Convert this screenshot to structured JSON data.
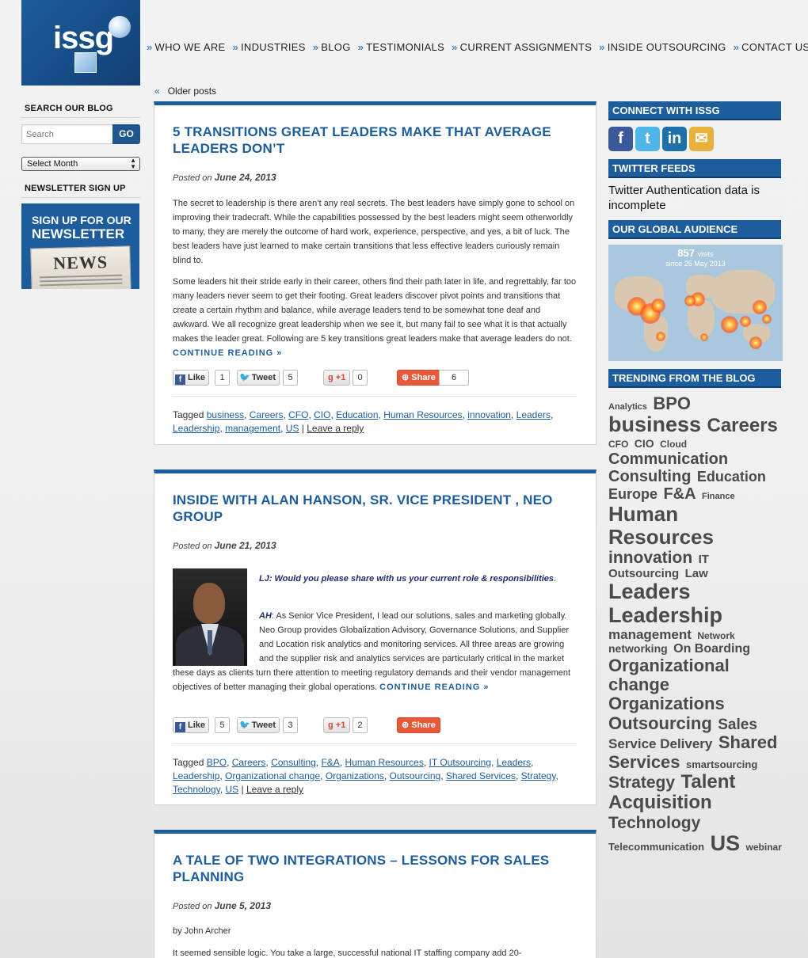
{
  "logo": {
    "text": "issg"
  },
  "nav": [
    "WHO WE ARE",
    "INDUSTRIES",
    "BLOG",
    "TESTIMONIALS",
    "CURRENT ASSIGNMENTS",
    "INSIDE OUTSOURCING",
    "CONTACT US"
  ],
  "nav_separator": "»",
  "older": {
    "arrow": "«",
    "label": "Older posts"
  },
  "left_sidebar": {
    "search_heading": "SEARCH OUR BLOG",
    "search_placeholder": "Search",
    "go_label": "GO",
    "month_select": "Select Month",
    "newsletter_heading": "NEWSLETTER SIGN UP",
    "newsletter_line1": "SIGN UP FOR OUR",
    "newsletter_line2": "NEWSLETTER",
    "newspaper_title": "NEWS"
  },
  "posts": [
    {
      "title": "5 TRANSITIONS GREAT LEADERS MAKE THAT AVERAGE LEADERS DON’T",
      "posted_on": "Posted on",
      "date": "June 24, 2013",
      "paragraphs": [
        "The secret to leadership is there aren’t any real secrets. The best leaders have simply gone to school on improving their tradecraft. While the capabilities possessed by the best leaders might seem otherworldly to many, they are merely the outcome of hard work, experience, perspective, and yes, a bit of luck. The best leaders have just learned to make certain transitions that less effective leaders curiously remain blind to.",
        "Some leaders hit their stride early in their career, others find their path later in life, and regrettably, far too many leaders never seem to get their footing. Great leaders discover pivot points and transitions that create a certain rhythm and balance, while average leaders tend to be somewhat tone deaf and awkward. We all recognize great leadership when we see it, but many fail to see what it is that actually makes the leader great. Following are 5 key transitions great leaders make that average leaders do not."
      ],
      "continue": "CONTINUE READING »",
      "share": {
        "like": "Like",
        "like_count": "1",
        "tweet": "Tweet",
        "tweet_count": "5",
        "gplus": "+1",
        "gplus_count": "0",
        "share": "Share",
        "share_count": "6"
      },
      "tagged": "Tagged",
      "tags": [
        "business",
        "Careers",
        "CFO",
        "CIO",
        "Education",
        "Human Resources",
        "innovation",
        "Leaders",
        "Leadership",
        "management",
        "US"
      ],
      "reply": "Leave a reply"
    },
    {
      "title": "INSIDE WITH ALAN HANSON, SR. VICE PRESIDENT , NEO GROUP",
      "posted_on": "Posted on",
      "date": "June 21, 2013",
      "question": "LJ: Would you please share with us your current role & responsibilities",
      "answer_label": "AH",
      "answer": ":  As Senior Vice President, I lead our solutions, sales and marketing globally. Neo Group provides Globalization Advisory, Governance Solutions, and Supplier and Location risk analytics and monitoring services.  All three areas are growing and the supplier risk and analytics services are particularly critical in the market these days as clients turn there attention to meeting regulatory demands and their vendor management objectives of better managing their global operations.",
      "continue": "CONTINUE READING »",
      "share": {
        "like": "Like",
        "like_count": "5",
        "tweet": "Tweet",
        "tweet_count": "3",
        "gplus": "+1",
        "gplus_count": "2",
        "share": "Share"
      },
      "tagged": "Tagged",
      "tags": [
        "BPO",
        "Careers",
        "Consulting",
        "F&A",
        "Human Resources",
        "IT Outsourcing",
        "Leaders",
        "Leadership",
        "Organizational change",
        "Organizations",
        "Outsourcing",
        "Shared Services",
        "Strategy",
        "Technology",
        "US"
      ],
      "reply": "Leave a reply"
    },
    {
      "title": "A TALE OF TWO INTEGRATIONS – LESSONS FOR SALES PLANNING",
      "posted_on": "Posted on",
      "date": "June 5, 2013",
      "byline": "by John Archer",
      "para": "It seemed sensible logic.  You take a large, successful national IT staffing company add 20-"
    }
  ],
  "right_sidebar": {
    "connect_heading": "CONNECT WITH ISSG",
    "social": [
      {
        "icon": "facebook-icon",
        "glyph": "f",
        "color": "#3b5998"
      },
      {
        "icon": "twitter-icon",
        "glyph": "t",
        "color": "#4fb7e8"
      },
      {
        "icon": "linkedin-icon",
        "glyph": "in",
        "color": "#1f70a8"
      },
      {
        "icon": "email-icon",
        "glyph": "✉",
        "color": "#e8b23a"
      }
    ],
    "twitter_heading": "TWITTER FEEDS",
    "twitter_msg": "Twitter Authentication data is incomplete",
    "audience_heading": "OUR GLOBAL AUDIENCE",
    "visits": "857",
    "visits_unit": "visits",
    "since": "since 25 May 2013",
    "trending_heading": "TRENDING FROM THE BLOG",
    "cloud": [
      {
        "t": "Analytics",
        "s": 11
      },
      {
        "t": "BPO",
        "s": 22
      },
      {
        "t": "business",
        "s": 27
      },
      {
        "t": "Careers",
        "s": 24
      },
      {
        "t": "CFO",
        "s": 12
      },
      {
        "t": "CIO",
        "s": 14
      },
      {
        "t": "Cloud",
        "s": 12
      },
      {
        "t": "Communication",
        "s": 20
      },
      {
        "t": "Consulting",
        "s": 20
      },
      {
        "t": "Education",
        "s": 18
      },
      {
        "t": "Europe",
        "s": 18
      },
      {
        "t": "F&A",
        "s": 20
      },
      {
        "t": "Finance",
        "s": 11
      },
      {
        "t": "Human Resources",
        "s": 26
      },
      {
        "t": "innovation",
        "s": 21
      },
      {
        "t": "IT Outsourcing",
        "s": 15
      },
      {
        "t": "Law",
        "s": 15
      },
      {
        "t": "Leaders",
        "s": 27
      },
      {
        "t": "Leadership",
        "s": 27
      },
      {
        "t": "management",
        "s": 17
      },
      {
        "t": "Network",
        "s": 12
      },
      {
        "t": "networking",
        "s": 14
      },
      {
        "t": "On Boarding",
        "s": 16
      },
      {
        "t": "Organizational change",
        "s": 22
      },
      {
        "t": "Organizations",
        "s": 22
      },
      {
        "t": "Outsourcing",
        "s": 22
      },
      {
        "t": "Sales",
        "s": 19
      },
      {
        "t": "Service Delivery",
        "s": 17
      },
      {
        "t": "Shared Services",
        "s": 22
      },
      {
        "t": "smartsourcing",
        "s": 13
      },
      {
        "t": "Strategy",
        "s": 21
      },
      {
        "t": "Talent Acquisition",
        "s": 24
      },
      {
        "t": "Technology",
        "s": 21
      },
      {
        "t": "Telecommunication",
        "s": 13
      },
      {
        "t": "US",
        "s": 27
      },
      {
        "t": "webinar",
        "s": 12
      }
    ]
  }
}
